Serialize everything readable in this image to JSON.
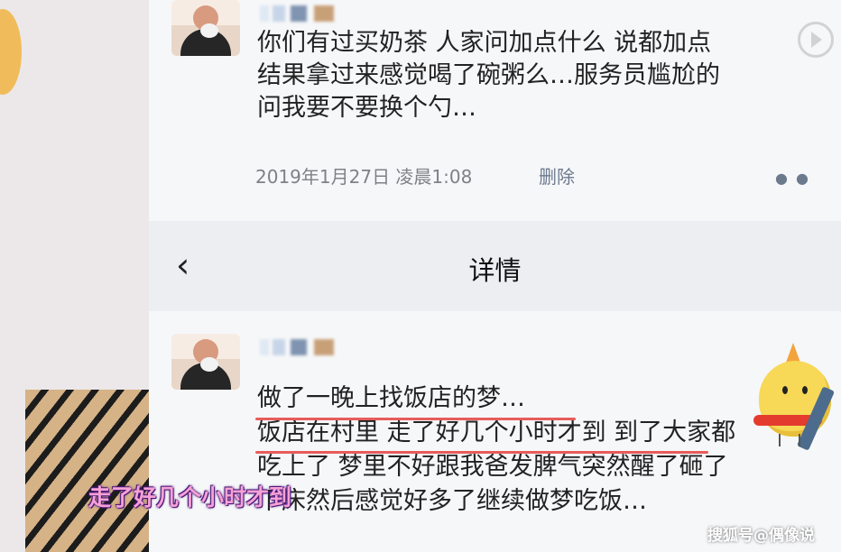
{
  "post1": {
    "lines": [
      "你们有过买奶茶 人家问加点什么 说都加点",
      "结果拿过来感觉喝了碗粥么…服务员尴尬的",
      "问我要不要换个勺…"
    ],
    "timestamp": "2019年1月27日 凌晨1:08",
    "delete_label": "删除"
  },
  "nav": {
    "title": "详情",
    "back_icon": "chevron-left-icon"
  },
  "post2": {
    "lines": [
      "做了一晚上找饭店的梦…",
      "饭店在村里 走了好几个小时才到 到了大家都",
      "吃上了 梦里不好跟我爸发脾气突然醒了砸了",
      "下床然后感觉好多了继续做梦吃饭…"
    ]
  },
  "overlay": {
    "caption": "走了好几个小时才到",
    "watermark": "搜狐号@偶像说"
  },
  "colors": {
    "underline": "#e85b5b",
    "link": "#6c7a8e",
    "caption": "#f6a1d6"
  }
}
